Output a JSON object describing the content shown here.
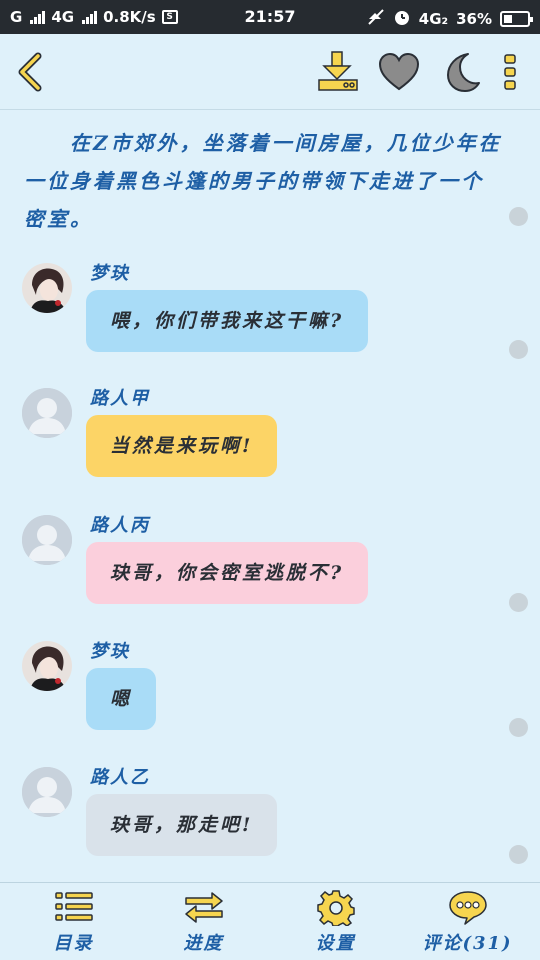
{
  "status_bar": {
    "carrier_g": "G",
    "network": "4G",
    "speed": "0.8K/s",
    "time": "21:57",
    "network_right": "4G₂",
    "battery": "36%",
    "battery_level": 0.36
  },
  "toolbar": {
    "back_icon": "chevron-left-icon",
    "download_icon": "download-icon",
    "favorite_icon": "heart-icon",
    "night_mode_icon": "moon-icon",
    "more_icon": "more-vertical-icon"
  },
  "story": {
    "narration": "在Z市郊外，坐落着一间房屋，几位少年在一位身着黑色斗篷的男子的带领下走进了一个密室。",
    "messages": [
      {
        "speaker": "梦玦",
        "text": "喂，你们带我来这干嘛?",
        "bubble_color": "#a9dcf7"
      },
      {
        "speaker": "路人甲",
        "text": "当然是来玩啊!",
        "bubble_color": "#fcd466"
      },
      {
        "speaker": "路人丙",
        "text": "玦哥，你会密室逃脱不?",
        "bubble_color": "#fbcfdc"
      },
      {
        "speaker": "梦玦",
        "text": "嗯",
        "bubble_color": "#a9dcf7"
      },
      {
        "speaker": "路人乙",
        "text": "玦哥，那走吧!",
        "bubble_color": "#d9e2ea"
      }
    ]
  },
  "bottom_nav": {
    "catalog": "目录",
    "progress": "进度",
    "settings": "设置",
    "comments": "评论(31)"
  },
  "colors": {
    "background": "#dff1fa",
    "accent_text": "#1e5fa5",
    "icon_yellow": "#f6d54f",
    "icon_gray": "#8b8b8b"
  }
}
